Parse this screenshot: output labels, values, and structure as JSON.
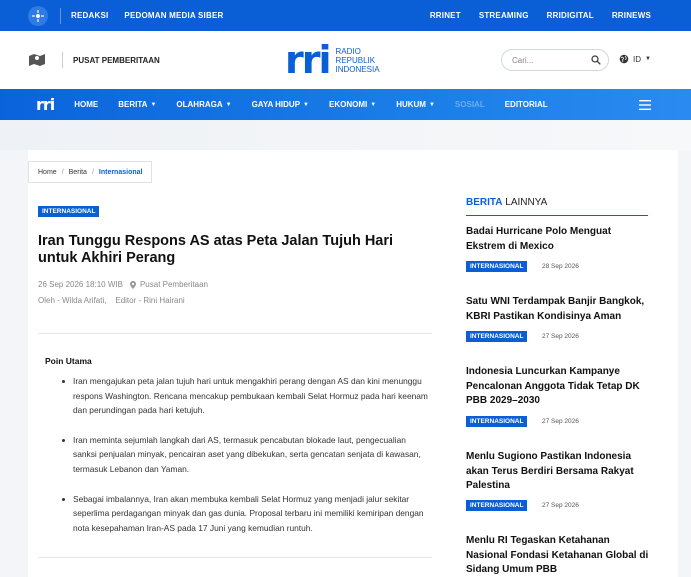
{
  "topbar": {
    "left_links": [
      "REDAKSI",
      "PEDOMAN MEDIA SIBER"
    ],
    "right_links": [
      "RRINET",
      "STREAMING",
      "RRIDIGITAL",
      "RRINEWS"
    ]
  },
  "header": {
    "region": "PUSAT PEMBERITAAN",
    "brand_mark": "rri",
    "brand_lines": [
      "RADIO",
      "REPUBLIK",
      "INDONESIA"
    ],
    "search_placeholder": "Cari...",
    "language": "ID"
  },
  "nav": {
    "logo": "rri",
    "items": [
      {
        "label": "HOME",
        "caret": false
      },
      {
        "label": "BERITA",
        "caret": true
      },
      {
        "label": "OLAHRAGA",
        "caret": true
      },
      {
        "label": "GAYA HIDUP",
        "caret": true
      },
      {
        "label": "EKONOMI",
        "caret": true
      },
      {
        "label": "HUKUM",
        "caret": true
      },
      {
        "label": "SOSIAL",
        "caret": false
      },
      {
        "label": "EDITORIAL",
        "caret": false
      }
    ]
  },
  "breadcrumb": {
    "home": "Home",
    "section": "Berita",
    "current": "Internasional"
  },
  "article": {
    "tag": "INTERNASIONAL",
    "title": "Iran Tunggu Respons AS atas Peta Jalan Tujuh Hari untuk Akhiri Perang",
    "datetime": "26 Sep 2026 18:10 WIB",
    "location": "Pusat Pemberitaan",
    "byline": "Oleh - Wilda Arifati,    Editor - Rini Hairani",
    "summary_heading": "Poin Utama",
    "points": [
      "Iran mengajukan peta jalan tujuh hari untuk mengakhiri perang dengan AS dan kini menunggu respons Washington. Rencana mencakup pembukaan kembali Selat Hormuz pada hari keenam dan perundingan pada hari ketujuh.",
      "Iran meminta sejumlah langkah dari AS, termasuk pencabutan blokade laut, pengecualian sanksi penjualan minyak, pencairan aset yang dibekukan, serta gencatan senjata di kawasan, termasuk Lebanon dan Yaman.",
      "Sebagai imbalannya, Iran akan membuka kembali Selat Hormuz yang menjadi jalur sekitar seperlima perdagangan minyak dan gas dunia. Proposal terbaru ini memiliki kemiripan dengan nota kesepahaman Iran-AS pada 17 Juni yang kemudian runtuh."
    ]
  },
  "sidebar": {
    "heading_bold": "BERITA",
    "heading_rest": " LAINNYA",
    "items": [
      {
        "title": "Badai Hurricane Polo Menguat Ekstrem di Mexico",
        "tag": "INTERNASIONAL",
        "date": "28 Sep 2026"
      },
      {
        "title": "Satu WNI Terdampak Banjir Bangkok, KBRI Pastikan Kondisinya Aman",
        "tag": "INTERNASIONAL",
        "date": "27 Sep 2026"
      },
      {
        "title": "Indonesia Luncurkan Kampanye Pencalonan Anggota Tidak Tetap DK PBB 2029–2030",
        "tag": "INTERNASIONAL",
        "date": "27 Sep 2026"
      },
      {
        "title": "Menlu Sugiono Pastikan Indonesia akan Terus Berdiri Bersama Rakyat Palestina",
        "tag": "INTERNASIONAL",
        "date": "27 Sep 2026"
      },
      {
        "title": "Menlu RI Tegaskan Ketahanan Nasional Fondasi Ketahanan Global di Sidang Umum PBB"
      }
    ]
  },
  "colors": {
    "brand_blue": "#0a5fd6",
    "top_bar": "#0a5fd6"
  },
  "icons": [
    "rri-logo-icon",
    "map-icon",
    "search-icon",
    "globe-icon",
    "chevron-down-icon",
    "location-pin-icon",
    "hamburger-menu-icon"
  ]
}
